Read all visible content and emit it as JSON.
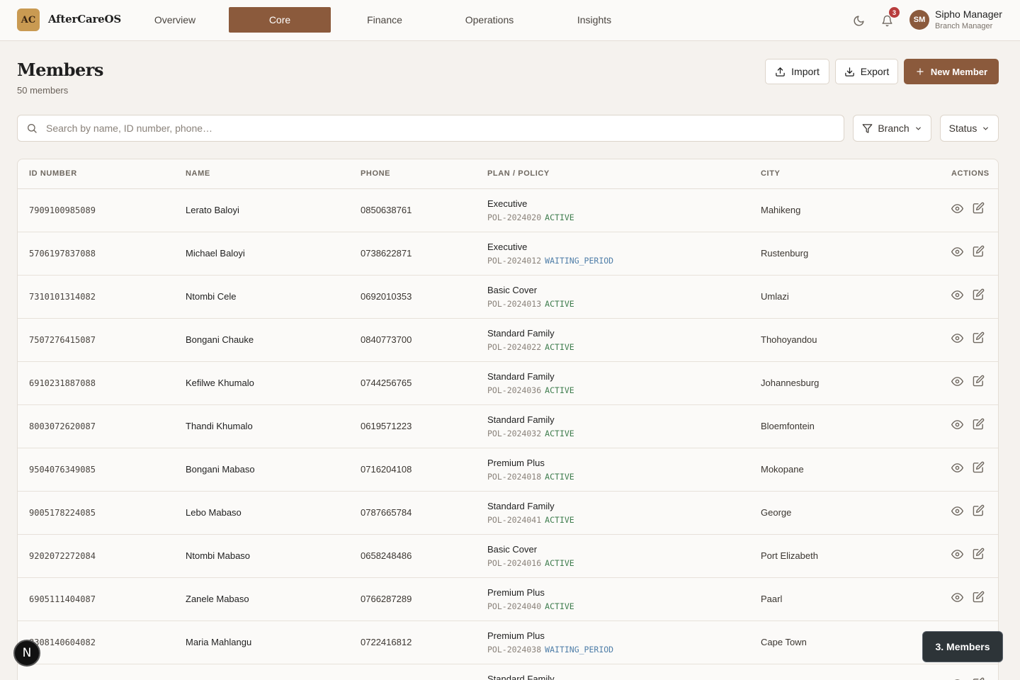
{
  "brand": {
    "badge": "AC",
    "name": "AfterCareOS"
  },
  "nav": {
    "tabs": [
      {
        "label": "Overview",
        "active": false
      },
      {
        "label": "Core",
        "active": true
      },
      {
        "label": "Finance",
        "active": false
      },
      {
        "label": "Operations",
        "active": false
      },
      {
        "label": "Insights",
        "active": false
      }
    ]
  },
  "header_right": {
    "notification_count": "3",
    "user": {
      "initials": "SM",
      "name": "Sipho Manager",
      "role": "Branch Manager"
    }
  },
  "page": {
    "title": "Members",
    "subtitle": "50 members",
    "import_label": "Import",
    "export_label": "Export",
    "new_label": "New Member"
  },
  "search": {
    "placeholder": "Search by name, ID number, phone…"
  },
  "filters": {
    "branch_label": "Branch",
    "status_label": "Status"
  },
  "table": {
    "columns": [
      "ID NUMBER",
      "NAME",
      "PHONE",
      "PLAN / POLICY",
      "CITY",
      "ACTIONS"
    ],
    "rows": [
      {
        "id": "7909100985089",
        "name": "Lerato Baloyi",
        "phone": "0850638761",
        "plan": "Executive",
        "policy": "POL-2024020",
        "status": "ACTIVE",
        "city": "Mahikeng"
      },
      {
        "id": "5706197837088",
        "name": "Michael Baloyi",
        "phone": "0738622871",
        "plan": "Executive",
        "policy": "POL-2024012",
        "status": "WAITING_PERIOD",
        "city": "Rustenburg"
      },
      {
        "id": "7310101314082",
        "name": "Ntombi Cele",
        "phone": "0692010353",
        "plan": "Basic Cover",
        "policy": "POL-2024013",
        "status": "ACTIVE",
        "city": "Umlazi"
      },
      {
        "id": "7507276415087",
        "name": "Bongani Chauke",
        "phone": "0840773700",
        "plan": "Standard Family",
        "policy": "POL-2024022",
        "status": "ACTIVE",
        "city": "Thohoyandou"
      },
      {
        "id": "6910231887088",
        "name": "Kefilwe Khumalo",
        "phone": "0744256765",
        "plan": "Standard Family",
        "policy": "POL-2024036",
        "status": "ACTIVE",
        "city": "Johannesburg"
      },
      {
        "id": "8003072620087",
        "name": "Thandi Khumalo",
        "phone": "0619571223",
        "plan": "Standard Family",
        "policy": "POL-2024032",
        "status": "ACTIVE",
        "city": "Bloemfontein"
      },
      {
        "id": "9504076349085",
        "name": "Bongani Mabaso",
        "phone": "0716204108",
        "plan": "Premium Plus",
        "policy": "POL-2024018",
        "status": "ACTIVE",
        "city": "Mokopane"
      },
      {
        "id": "9005178224085",
        "name": "Lebo Mabaso",
        "phone": "0787665784",
        "plan": "Standard Family",
        "policy": "POL-2024041",
        "status": "ACTIVE",
        "city": "George"
      },
      {
        "id": "9202072272084",
        "name": "Ntombi Mabaso",
        "phone": "0658248486",
        "plan": "Basic Cover",
        "policy": "POL-2024016",
        "status": "ACTIVE",
        "city": "Port Elizabeth"
      },
      {
        "id": "6905111404087",
        "name": "Zanele Mabaso",
        "phone": "0766287289",
        "plan": "Premium Plus",
        "policy": "POL-2024040",
        "status": "ACTIVE",
        "city": "Paarl"
      },
      {
        "id": "8308140604082",
        "name": "Maria Mahlangu",
        "phone": "0722416812",
        "plan": "Premium Plus",
        "policy": "POL-2024038",
        "status": "WAITING_PERIOD",
        "city": "Cape Town"
      },
      {
        "id": "",
        "name": "",
        "phone": "",
        "plan": "Standard Family",
        "policy": "",
        "status": "",
        "city": ""
      }
    ]
  },
  "floating": {
    "n_badge": "N",
    "toast": "3. Members"
  },
  "colors": {
    "accent": "#8b5a3c",
    "logo": "#c99a52",
    "active_status": "#3f7d4e",
    "waiting_status": "#4f7ea8",
    "badge": "#b83d3d"
  }
}
